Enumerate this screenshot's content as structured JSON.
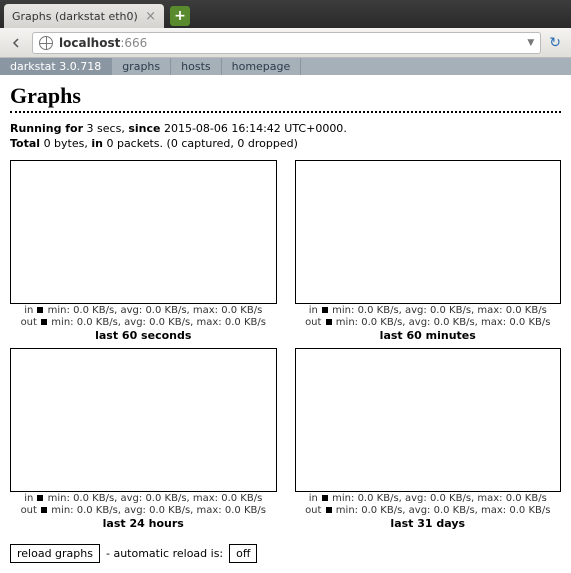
{
  "browser": {
    "tab_title": "Graphs (darkstat eth0)",
    "url_host": "localhost",
    "url_port": ":666"
  },
  "nav": {
    "version": "darkstat 3.0.718",
    "items": [
      "graphs",
      "hosts",
      "homepage"
    ]
  },
  "page_title": "Graphs",
  "status": {
    "running_label": "Running for",
    "running_value": "3 secs,",
    "since_label": "since",
    "since_value": "2015-08-06 16:14:42 UTC+0000",
    "total_label": "Total",
    "total_bytes": "0 bytes,",
    "in_label": "in",
    "packets": "0 packets.",
    "captured_dropped": "(0 captured, 0 dropped)"
  },
  "stat_template": {
    "in": "in",
    "out": "out",
    "min": "min: 0.0 KB/s,",
    "avg": "avg: 0.0 KB/s,",
    "max": "max: 0.0 KB/s"
  },
  "graphs": [
    {
      "title": "last 60 seconds"
    },
    {
      "title": "last 60 minutes"
    },
    {
      "title": "last 24 hours"
    },
    {
      "title": "last 31 days"
    }
  ],
  "footer": {
    "reload_button": "reload graphs",
    "auto_label": "- automatic reload is:",
    "toggle": "off"
  },
  "chart_data": [
    {
      "type": "bar",
      "title": "last 60 seconds",
      "series": [
        {
          "name": "in",
          "values": []
        },
        {
          "name": "out",
          "values": []
        }
      ],
      "ylabel": "KB/s"
    },
    {
      "type": "bar",
      "title": "last 60 minutes",
      "series": [
        {
          "name": "in",
          "values": []
        },
        {
          "name": "out",
          "values": []
        }
      ],
      "ylabel": "KB/s"
    },
    {
      "type": "bar",
      "title": "last 24 hours",
      "series": [
        {
          "name": "in",
          "values": []
        },
        {
          "name": "out",
          "values": []
        }
      ],
      "ylabel": "KB/s"
    },
    {
      "type": "bar",
      "title": "last 31 days",
      "series": [
        {
          "name": "in",
          "values": []
        },
        {
          "name": "out",
          "values": []
        }
      ],
      "ylabel": "KB/s"
    }
  ]
}
